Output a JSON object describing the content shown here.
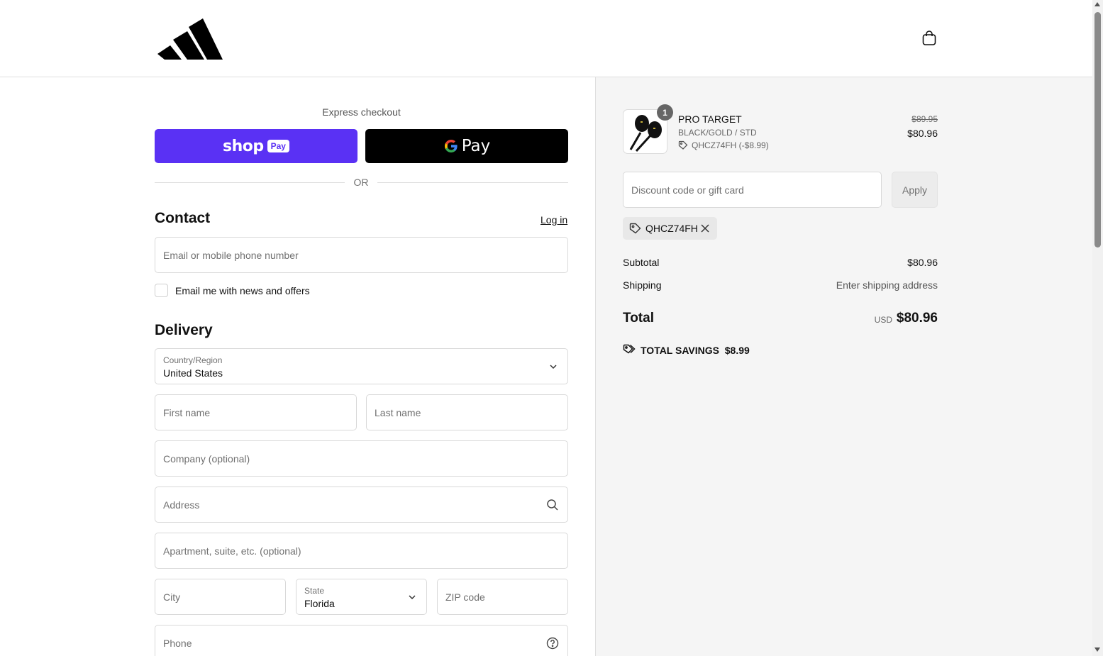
{
  "header": {
    "brand": "adidas"
  },
  "express": {
    "label": "Express checkout",
    "shop_word": "shop",
    "shop_pill": "Pay",
    "gpay_word": "Pay",
    "or": "OR"
  },
  "contact": {
    "title": "Contact",
    "login": "Log in",
    "email_placeholder": "Email or mobile phone number",
    "news_label": "Email me with news and offers"
  },
  "delivery": {
    "title": "Delivery",
    "country_label": "Country/Region",
    "country_value": "United States",
    "first_name": "First name",
    "last_name": "Last name",
    "company": "Company (optional)",
    "address": "Address",
    "apartment": "Apartment, suite, etc. (optional)",
    "city": "City",
    "state_label": "State",
    "state_value": "Florida",
    "zip": "ZIP code",
    "phone": "Phone"
  },
  "summary": {
    "product": {
      "quantity": "1",
      "name": "PRO TARGET",
      "variant": "BLACK/GOLD / STD",
      "discount": "QHCZ74FH (-$8.99)",
      "original_price": "$89.95",
      "price": "$80.96"
    },
    "discount_placeholder": "Discount code or gift card",
    "apply": "Apply",
    "applied_code": "QHCZ74FH",
    "subtotal_label": "Subtotal",
    "subtotal_value": "$80.96",
    "shipping_label": "Shipping",
    "shipping_value": "Enter shipping address",
    "total_label": "Total",
    "currency": "USD",
    "total_value": "$80.96",
    "savings_label": "TOTAL SAVINGS",
    "savings_value": "$8.99"
  },
  "colors": {
    "shop_pay": "#5a31f4",
    "gpay": "#000000",
    "summary_bg": "#f5f5f5"
  }
}
